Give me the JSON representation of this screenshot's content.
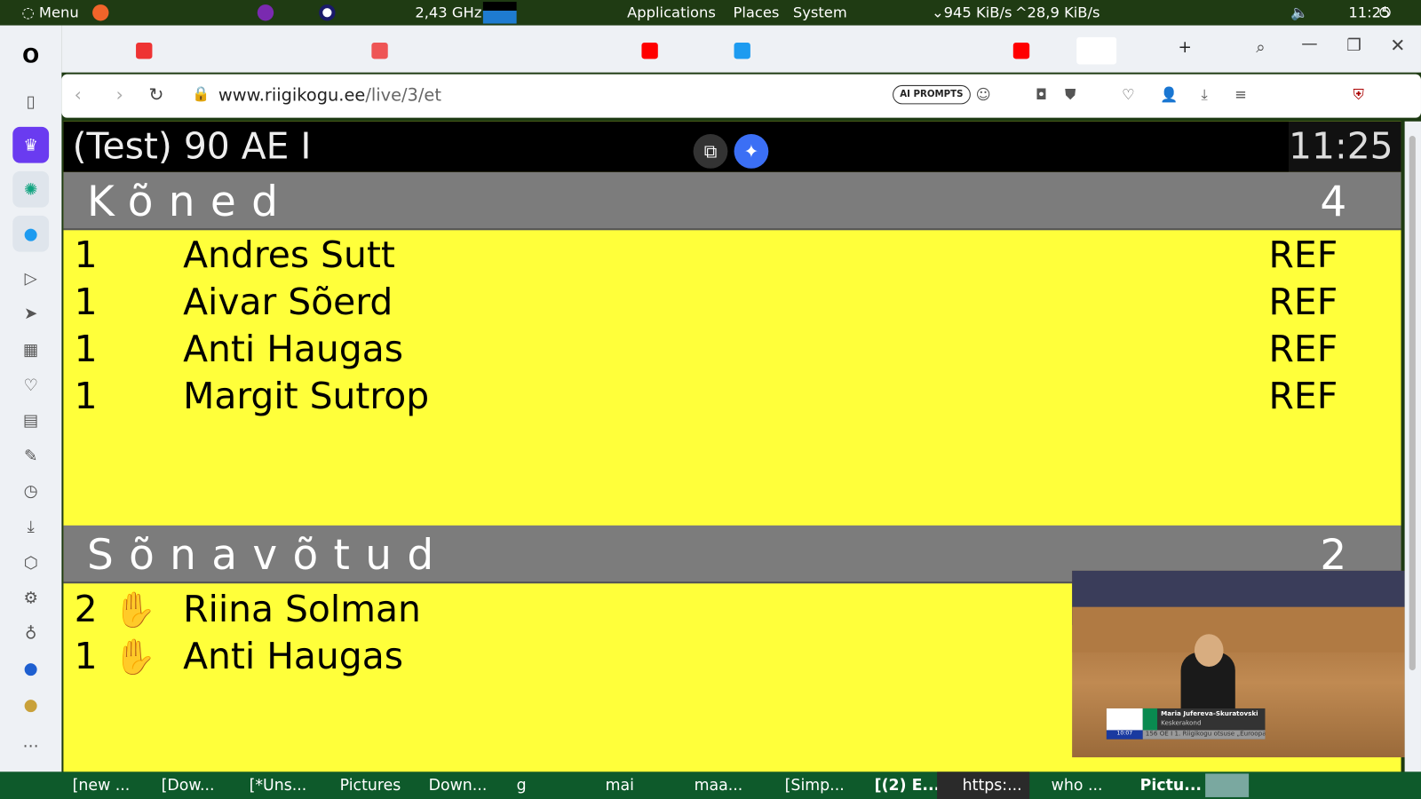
{
  "topbar": {
    "menu": "Menu",
    "cpu": "2,43 GHz",
    "applications": "Applications",
    "places": "Places",
    "system": "System",
    "net": "945 KiB/s",
    "net_up": "28,9 KiB/s",
    "time": "11:25"
  },
  "browser": {
    "url_host": "www.riigikogu.ee",
    "url_path": "/live/3/et",
    "ai_prompts": "AI PROMPTS"
  },
  "page": {
    "title": "(Test) 90 AE I",
    "clock": "11:25",
    "speeches": {
      "heading": "Kõned",
      "count": "4",
      "rows": [
        {
          "num": "1",
          "name": "Andres Sutt",
          "tag": "REF"
        },
        {
          "num": "1",
          "name": "Aivar Sõerd",
          "tag": "REF"
        },
        {
          "num": "1",
          "name": "Anti Haugas",
          "tag": "REF"
        },
        {
          "num": "1",
          "name": "Margit Sutrop",
          "tag": "REF"
        }
      ]
    },
    "requests": {
      "heading": "Sõnavõtud",
      "count": "2",
      "rows": [
        {
          "num": "2",
          "name": "Riina Solman"
        },
        {
          "num": "1",
          "name": "Anti Haugas"
        }
      ]
    }
  },
  "video": {
    "speaker": "Maria Jufereva-Skuratovski",
    "faction": "Keskerakond",
    "time": "10:07",
    "caption": "156 OE I 1. Riigikogu otsuse „Euroopa ..."
  },
  "taskbar": {
    "items": [
      "[new ...",
      "[Dow...",
      "[*Uns...",
      "Pictures",
      "Down...",
      "g",
      "mai",
      "maa...",
      "[Simp...",
      "[(2) E...",
      "https:...",
      "who ...",
      "Pictu..."
    ]
  }
}
